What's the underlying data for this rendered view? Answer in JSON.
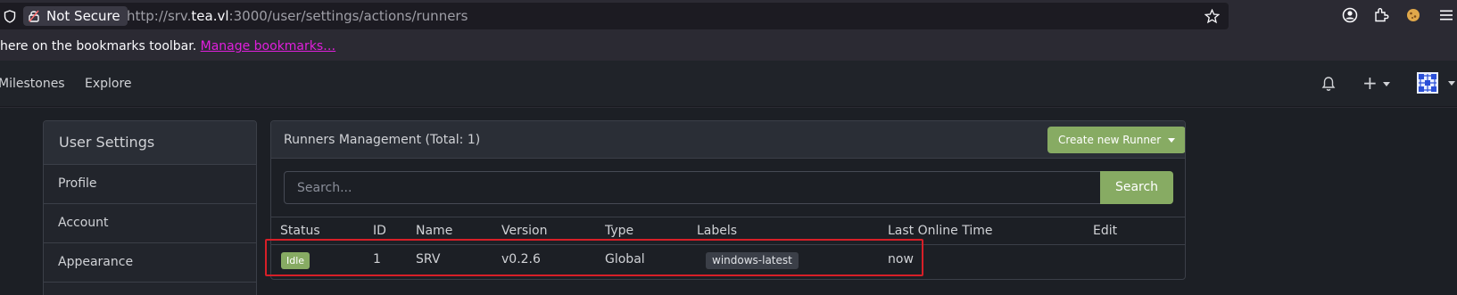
{
  "browser": {
    "security_label": "Not Secure",
    "url_prefix": "http://srv.",
    "url_host": "tea.vl",
    "url_suffix": ":3000/user/settings/actions/runners",
    "bookmarks_text": "here on the bookmarks toolbar. ",
    "bookmarks_link": "Manage bookmarks…"
  },
  "nav": {
    "items": [
      "Milestones",
      "Explore"
    ],
    "plus": "+"
  },
  "sidebar": {
    "heading": "User Settings",
    "items": [
      "Profile",
      "Account",
      "Appearance"
    ]
  },
  "runners": {
    "title": "Runners Management (Total: 1)",
    "create_button": "Create new Runner",
    "search_placeholder": "Search...",
    "search_button": "Search",
    "columns": [
      "Status",
      "ID",
      "Name",
      "Version",
      "Type",
      "Labels",
      "Last Online Time",
      "Edit"
    ],
    "rows": [
      {
        "status": "Idle",
        "id": "1",
        "name": "SRV",
        "version": "v0.2.6",
        "type": "Global",
        "labels": "windows-latest",
        "last_online": "now"
      }
    ]
  },
  "colors": {
    "accent": "#87ab63",
    "highlight": "#d71f28",
    "link": "#e11fdd"
  }
}
